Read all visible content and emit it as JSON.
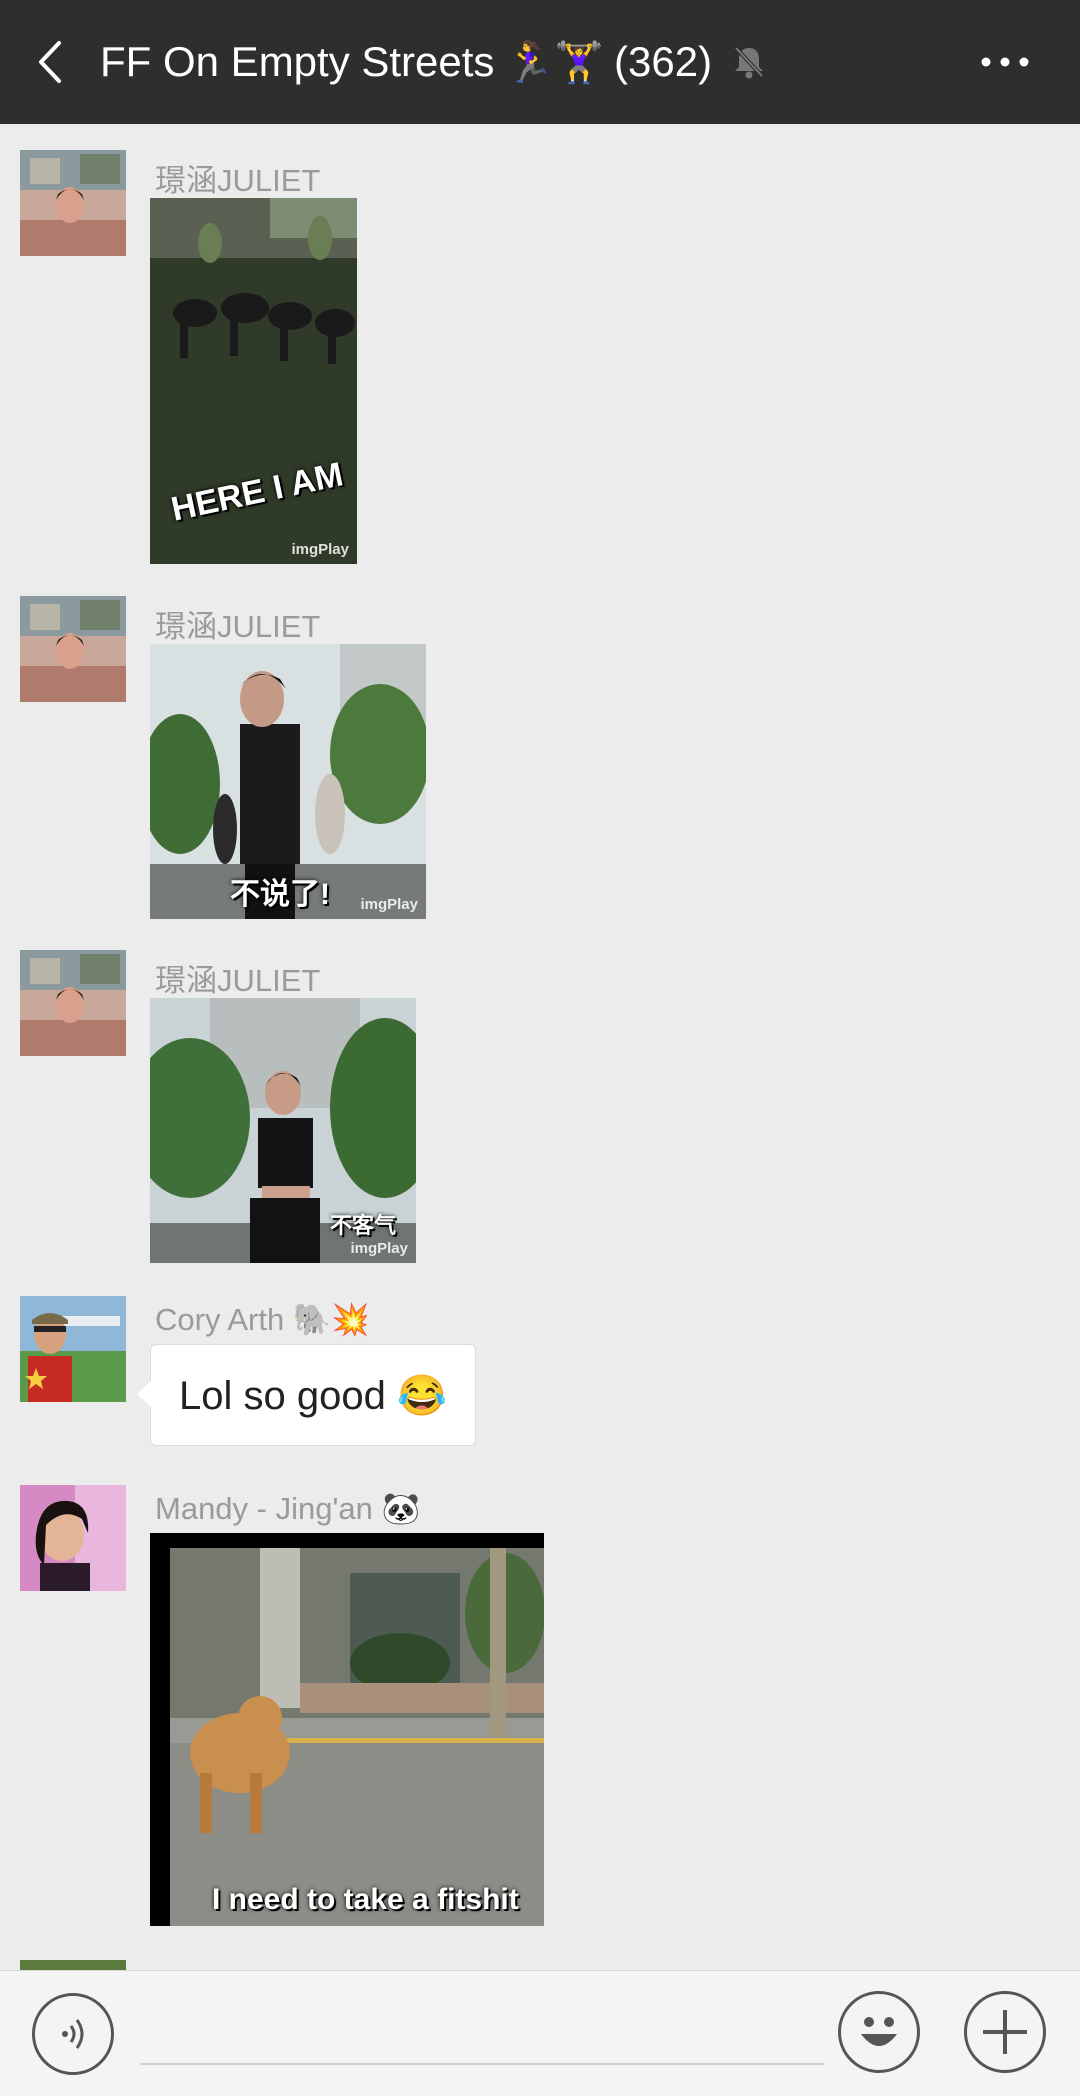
{
  "header": {
    "title": "FF On Empty Streets",
    "title_emoji": "🏃‍♀️🏋️‍♀️",
    "member_count": "(362)",
    "icons": [
      "back-arrow-icon",
      "muted-bell-icon",
      "more-icon"
    ]
  },
  "messages": [
    {
      "sender": "璟涵JULIET",
      "type": "gif",
      "caption": "HERE I AM",
      "watermark": "imgPlay"
    },
    {
      "sender": "璟涵JULIET",
      "type": "gif",
      "caption": "不说了!",
      "watermark": "imgPlay"
    },
    {
      "sender": "璟涵JULIET",
      "type": "gif",
      "caption": "不客气",
      "watermark": "imgPlay"
    },
    {
      "sender": "Cory Arth 🐘💥",
      "type": "text",
      "text": "Lol so good 😂"
    },
    {
      "sender": "Mandy - Jing'an 🐼",
      "type": "gif",
      "caption": "I need to take a fitshit"
    }
  ],
  "input": {
    "value": "",
    "icons": [
      "voice-icon",
      "emoji-icon",
      "plus-icon"
    ]
  }
}
